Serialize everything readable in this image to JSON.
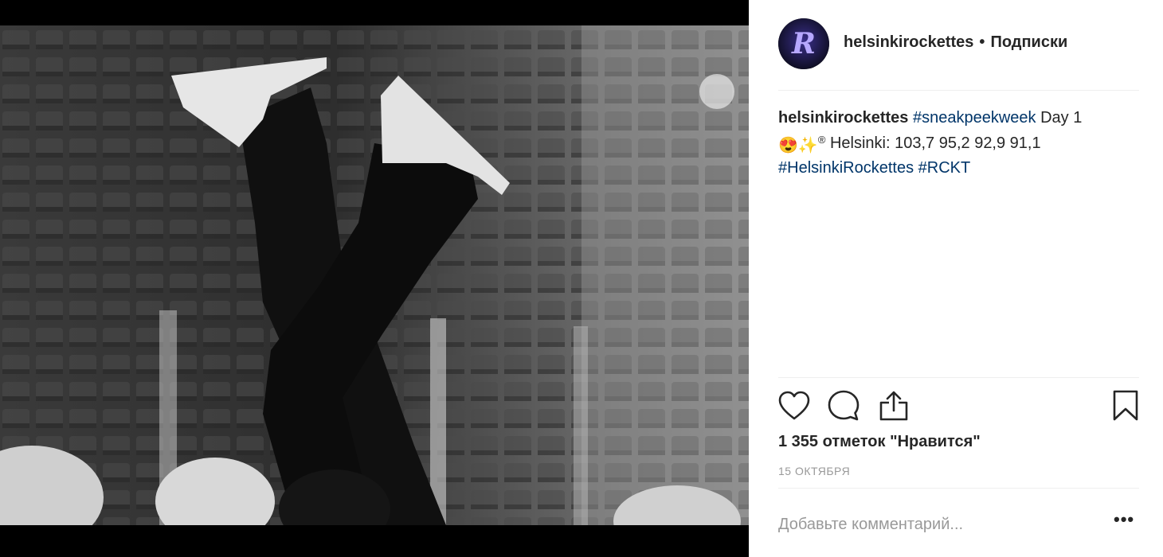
{
  "post": {
    "image_alt": "Black and white photo of figure skaters' legs raised with skates in an arena",
    "username": "helsinkirockettes",
    "separator": "•",
    "follow_label": "Подписки",
    "caption": {
      "username": "helsinkirockettes",
      "hashtag_sneak": "#sneakpeekweek",
      "text_day": "Day 1",
      "emoji_1": "😍",
      "emoji_2": "✨",
      "emoji_3": "®",
      "text_scores": "Helsinki: 103,7 95,2 92,9 91,1",
      "hashtag_team": "#HelsinkiRockettes",
      "hashtag_rckt": "#RCKT"
    },
    "likes_text": "1 355 отметок \"Нравится\"",
    "date_text": "15 ОКТЯБРЯ",
    "comment_placeholder": "Добавьте комментарий...",
    "more_label": "•••"
  },
  "icons": {
    "like": "heart-icon",
    "comment": "comment-bubble-icon",
    "share": "share-icon",
    "save": "bookmark-icon",
    "more": "more-options-icon"
  },
  "colors": {
    "text": "#262626",
    "hashtag": "#003569",
    "muted": "#999999",
    "divider": "#efefef",
    "avatar_letter": "#7b6ad8"
  }
}
